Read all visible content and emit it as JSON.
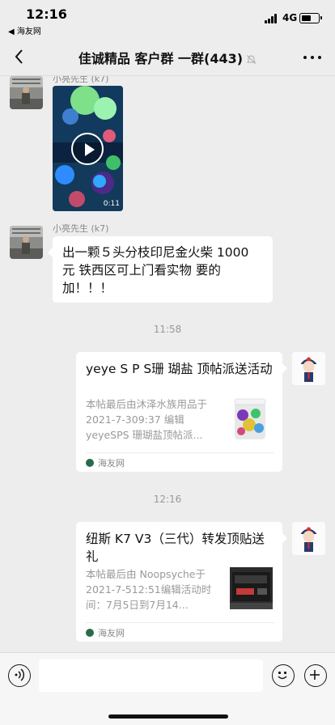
{
  "status_bar": {
    "time": "12:16",
    "back_app": "◀ 海友网",
    "network": "4G"
  },
  "nav": {
    "title": "佳诚精品 客户群 一群(443)"
  },
  "messages": [
    {
      "kind": "video",
      "sender": "小亮先生 (k7)",
      "duration": "0:11"
    },
    {
      "kind": "text",
      "sender": "小亮先生 (k7)",
      "text": "出一颗５头分枝印尼金火柴 1000 元 铁西区可上门看实物 要的加！！！"
    },
    {
      "kind": "time",
      "text": "11:58"
    },
    {
      "kind": "card",
      "title": "yeye S P S珊 瑚盐 顶帖派送活动",
      "desc": "本帖最后由沐泽水族用品于 2021-7-309:37 编辑\nyeyeSPS 珊瑚盐顶帖派...",
      "source": "海友网"
    },
    {
      "kind": "time",
      "text": "12:16"
    },
    {
      "kind": "card",
      "title": "纽斯 K7 V3（三代）转发顶贴送礼",
      "desc": "本帖最后由 Noopsyche于 2021-7-512:51编辑活动时间：7月5日到7月14...",
      "source": "海友网"
    }
  ],
  "input": {
    "value": "",
    "placeholder": ""
  },
  "colors": {
    "background": "#ededed",
    "bubble": "#ffffff",
    "source_icon": "#2a6b4a"
  },
  "icons": {
    "back": "chevron-left-icon",
    "mute": "bell-off-icon",
    "more": "more-dots-icon",
    "voice": "voice-icon",
    "emoji": "emoji-icon",
    "plus": "plus-icon"
  }
}
